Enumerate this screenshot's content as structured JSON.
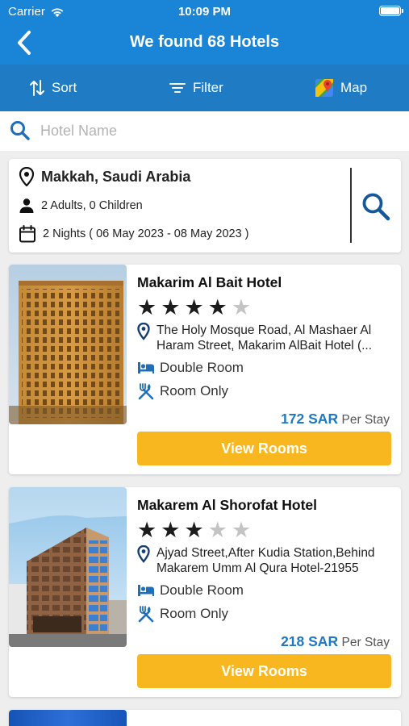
{
  "status_bar": {
    "carrier": "Carrier",
    "time": "10:09 PM"
  },
  "nav": {
    "title": "We found 68 Hotels"
  },
  "toolbar": {
    "sort_label": "Sort",
    "filter_label": "Filter",
    "map_label": "Map"
  },
  "search": {
    "placeholder": "Hotel Name",
    "value": ""
  },
  "summary": {
    "location": "Makkah, Saudi Arabia",
    "guests": "2 Adults, 0 Children",
    "nights": "2 Nights ( 06 May 2023 - 08 May 2023 )"
  },
  "hotels": [
    {
      "name": "Makarim Al Bait Hotel",
      "rating": 4,
      "max_rating": 5,
      "address": "The Holy Mosque Road, Al Mashaer Al Haram Street, Makarim AlBait Hotel (...",
      "room_type": "Double Room",
      "meal": "Room Only",
      "price": "172 SAR",
      "price_unit": "Per Stay",
      "button_label": "View Rooms"
    },
    {
      "name": "Makarem Al Shorofat Hotel",
      "rating": 3,
      "max_rating": 5,
      "address": "Ajyad Street,After Kudia Station,Behind Makarem Umm Al Qura Hotel-21955",
      "room_type": "Double Room",
      "meal": "Room Only",
      "price": "218 SAR",
      "price_unit": "Per Stay",
      "button_label": "View Rooms"
    }
  ],
  "colors": {
    "header": "#1a84d6",
    "toolbar": "#1f7cc4",
    "price": "#1f78c1",
    "button": "#f9b71f",
    "icon": "#1f6fb8"
  }
}
